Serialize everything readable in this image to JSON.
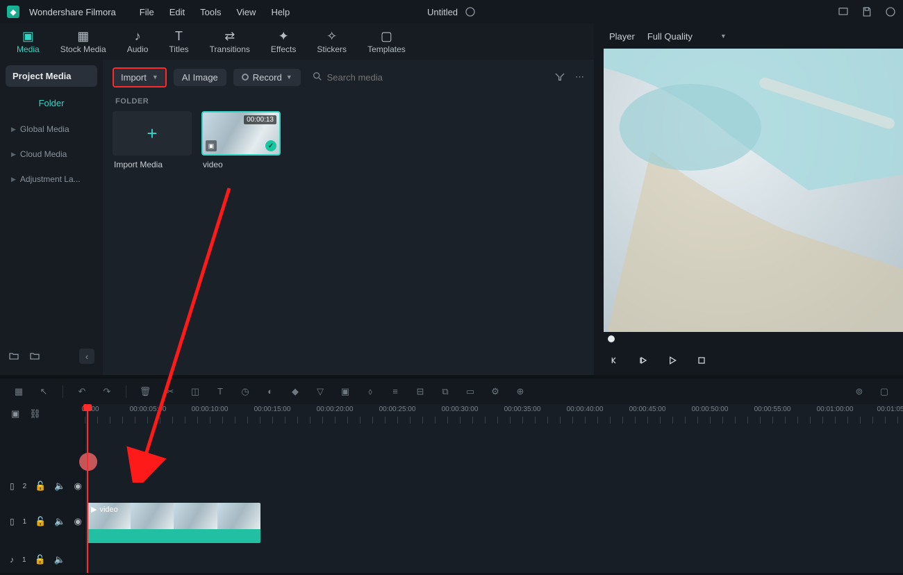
{
  "app_name": "Wondershare Filmora",
  "menu": {
    "file": "File",
    "edit": "Edit",
    "tools": "Tools",
    "view": "View",
    "help": "Help"
  },
  "title": "Untitled",
  "tabs": {
    "media": "Media",
    "stock": "Stock Media",
    "audio": "Audio",
    "titles": "Titles",
    "transitions": "Transitions",
    "effects": "Effects",
    "stickers": "Stickers",
    "templates": "Templates"
  },
  "sidebar": {
    "project_media": "Project Media",
    "folder": "Folder",
    "global_media": "Global Media",
    "cloud_media": "Cloud Media",
    "adjustment": "Adjustment La..."
  },
  "toolbar": {
    "import": "Import",
    "ai_image": "AI Image",
    "record": "Record",
    "search_placeholder": "Search media"
  },
  "folder_label": "FOLDER",
  "thumbs": {
    "import_media": "Import Media",
    "video_name": "video",
    "video_duration": "00:00:13"
  },
  "player": {
    "label": "Player",
    "quality": "Full Quality"
  },
  "timeline": {
    "labels": [
      "00:00",
      "00:00:05:00",
      "00:00:10:00",
      "00:00:15:00",
      "00:00:20:00",
      "00:00:25:00",
      "00:00:30:00",
      "00:00:35:00",
      "00:00:40:00",
      "00:00:45:00",
      "00:00:50:00",
      "00:00:55:00",
      "00:01:00:00",
      "00:01:05"
    ],
    "track_v2": "2",
    "track_v1": "1",
    "track_a1": "1",
    "clip_name": "video"
  }
}
